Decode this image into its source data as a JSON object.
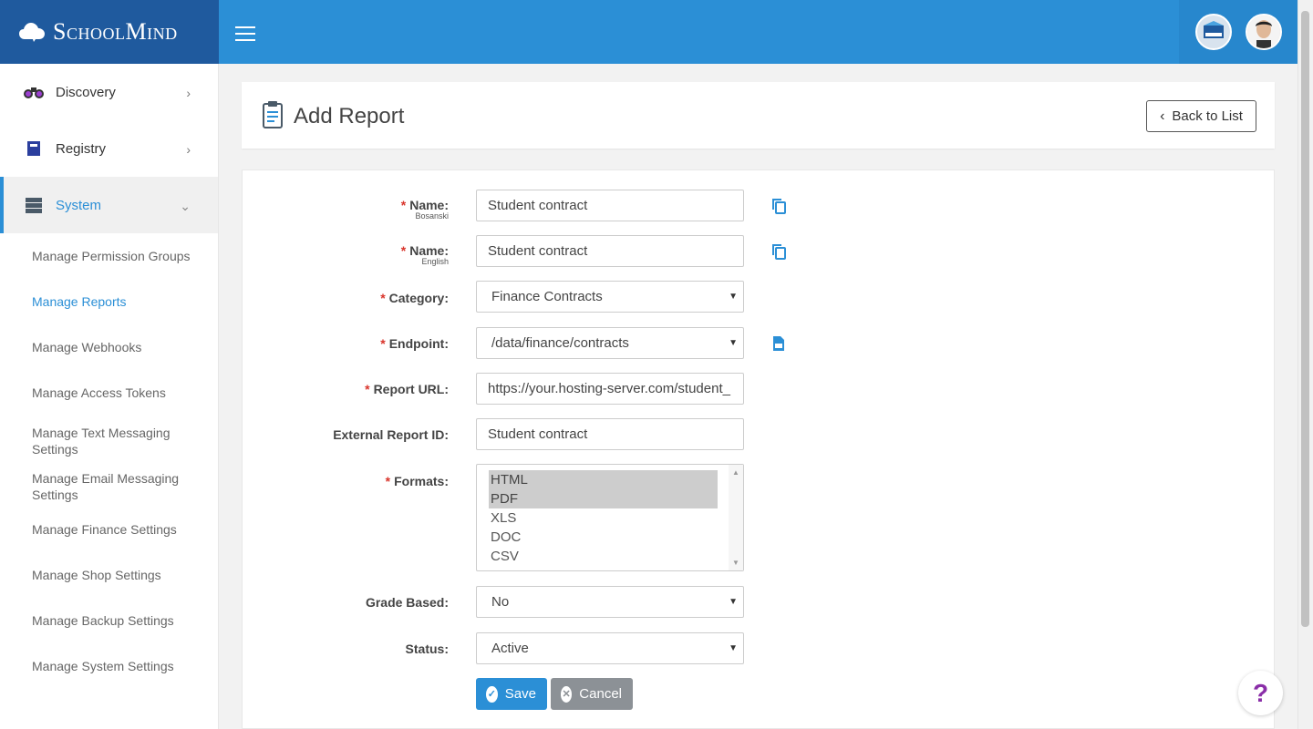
{
  "brand": {
    "name": "SchoolMind"
  },
  "topbar": {
    "menu_icon": "hamburger-icon",
    "school_avatar": "school-logo-icon",
    "user_avatar": "user-avatar"
  },
  "sidebar": {
    "items": [
      {
        "label": "Discovery",
        "icon": "binoculars-icon"
      },
      {
        "label": "Registry",
        "icon": "book-icon"
      },
      {
        "label": "System",
        "icon": "server-icon"
      }
    ],
    "sub_items": [
      "Manage Permission Groups",
      "Manage Reports",
      "Manage Webhooks",
      "Manage Access Tokens",
      "Manage Text Messaging Settings",
      "Manage Email Messaging Settings",
      "Manage Finance Settings",
      "Manage Shop Settings",
      "Manage Backup Settings",
      "Manage System Settings"
    ]
  },
  "header": {
    "title": "Add Report",
    "back_label": "Back to List"
  },
  "form": {
    "name_bs": {
      "label": "Name:",
      "sub": "Bosanski",
      "value": "Student contract"
    },
    "name_en": {
      "label": "Name:",
      "sub": "English",
      "value": "Student contract"
    },
    "category": {
      "label": "Category:",
      "value": "Finance Contracts"
    },
    "endpoint": {
      "label": "Endpoint:",
      "value": "/data/finance/contracts"
    },
    "report_url": {
      "label": "Report URL:",
      "value": "https://your.hosting-server.com/student_"
    },
    "external_id": {
      "label": "External Report ID:",
      "value": "Student contract"
    },
    "formats": {
      "label": "Formats:",
      "options": [
        "HTML",
        "PDF",
        "XLS",
        "DOC",
        "CSV"
      ],
      "selected": [
        "HTML",
        "PDF"
      ]
    },
    "grade_based": {
      "label": "Grade Based:",
      "value": "No"
    },
    "status": {
      "label": "Status:",
      "value": "Active"
    },
    "required_mark": "*",
    "save_label": "Save",
    "cancel_label": "Cancel"
  },
  "help": {
    "label": "?"
  },
  "colors": {
    "primary": "#2b8fd6",
    "brand_dark": "#1f5a9e",
    "required": "#d9342b",
    "cancel": "#8c9196",
    "help": "#8a2ea8"
  }
}
